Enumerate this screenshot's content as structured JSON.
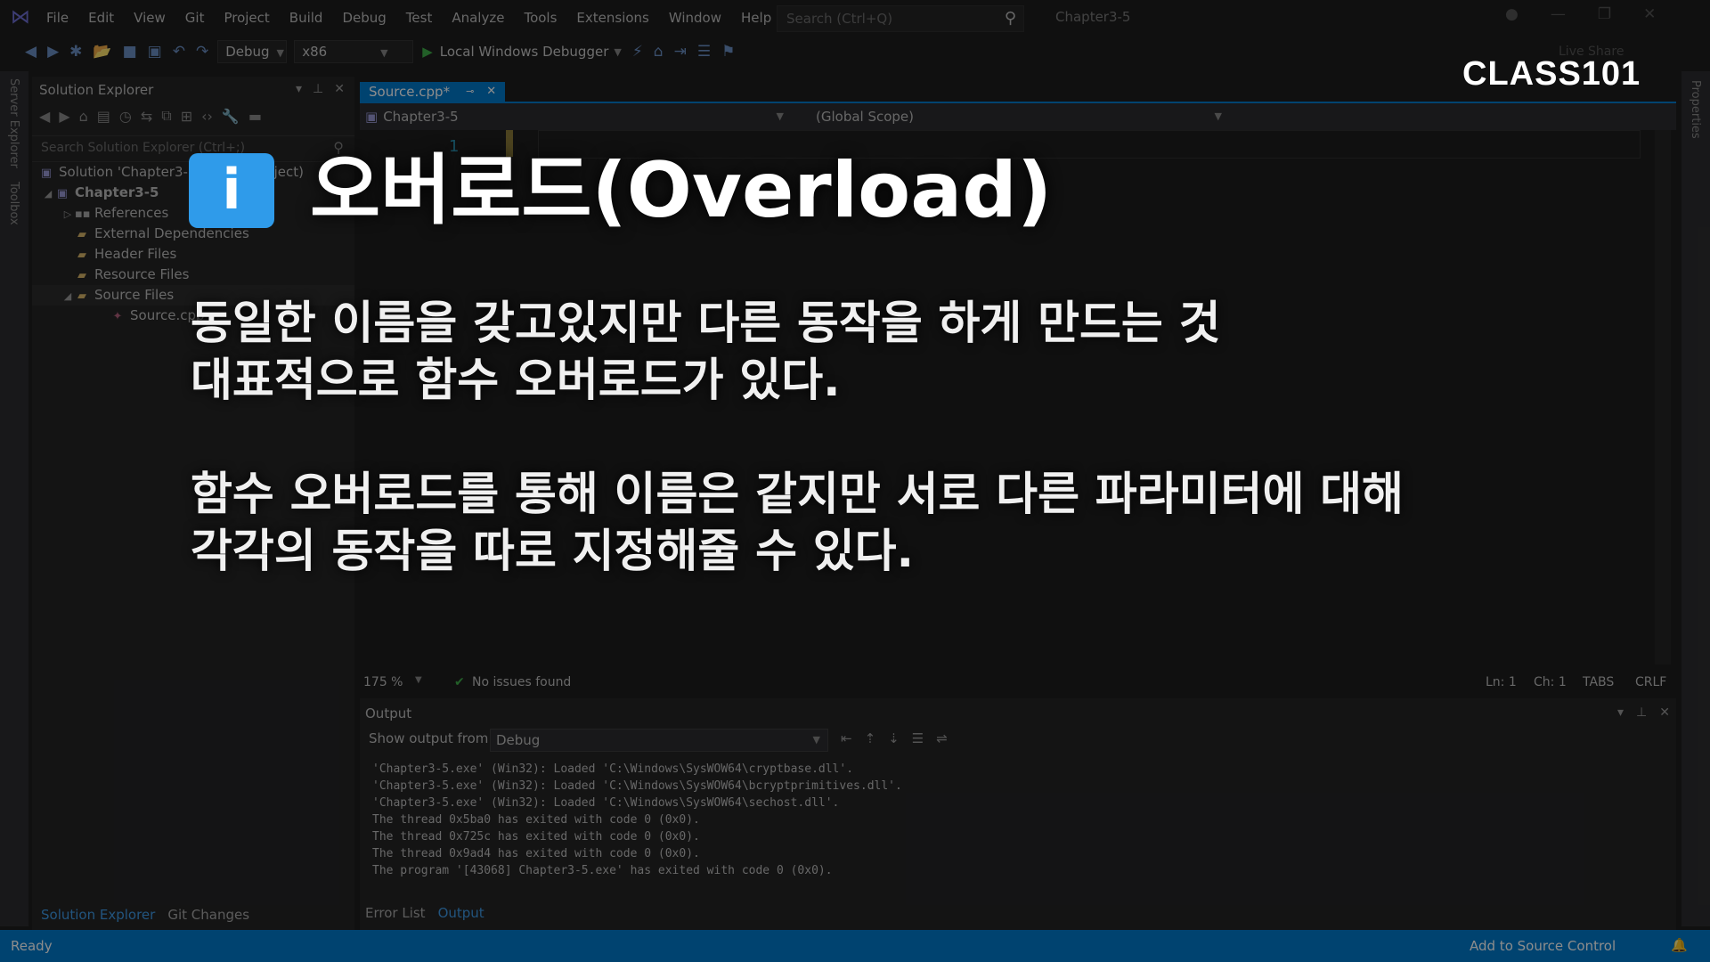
{
  "titlebar": {
    "menu": [
      "File",
      "Edit",
      "View",
      "Git",
      "Project",
      "Build",
      "Debug",
      "Test",
      "Analyze",
      "Tools",
      "Extensions",
      "Window",
      "Help"
    ],
    "search_placeholder": "Search (Ctrl+Q)",
    "project_title": "Chapter3-5"
  },
  "toolbar": {
    "config": "Debug",
    "platform": "x86",
    "run_label": "Local Windows Debugger",
    "live_share": "Live Share"
  },
  "brand": "CLASS101",
  "side_tabs": {
    "server_explorer": "Server Explorer",
    "toolbox": "Toolbox",
    "properties": "Properties"
  },
  "solution_explorer": {
    "title": "Solution Explorer",
    "search_placeholder": "Search Solution Explorer (Ctrl+;)",
    "items": [
      {
        "label": "Solution 'Chapter3-5' (1 of 1 project)"
      },
      {
        "label": "Chapter3-5"
      },
      {
        "label": "References"
      },
      {
        "label": "External Dependencies"
      },
      {
        "label": "Header Files"
      },
      {
        "label": "Resource Files"
      },
      {
        "label": "Source Files"
      },
      {
        "label": "Source.cpp"
      }
    ],
    "bottom_tabs": [
      "Solution Explorer",
      "Git Changes"
    ]
  },
  "editor": {
    "tab_label": "Source.cpp*",
    "nav_project": "Chapter3-5",
    "nav_scope": "(Global Scope)",
    "line_number": "1",
    "zoom": "175 %",
    "issues": "No issues found",
    "ln": "Ln: 1",
    "ch": "Ch: 1",
    "tabs": "TABS",
    "eol": "CRLF"
  },
  "output": {
    "title": "Output",
    "show_from_label": "Show output from:",
    "show_from_value": "Debug",
    "lines": [
      "'Chapter3-5.exe' (Win32): Loaded 'C:\\Windows\\SysWOW64\\cryptbase.dll'.",
      "'Chapter3-5.exe' (Win32): Loaded 'C:\\Windows\\SysWOW64\\bcryptprimitives.dll'.",
      "'Chapter3-5.exe' (Win32): Loaded 'C:\\Windows\\SysWOW64\\sechost.dll'.",
      "The thread 0x5ba0 has exited with code 0 (0x0).",
      "The thread 0x725c has exited with code 0 (0x0).",
      "The thread 0x9ad4 has exited with code 0 (0x0).",
      "The program '[43068] Chapter3-5.exe' has exited with code 0 (0x0)."
    ],
    "tabs": [
      "Error List",
      "Output"
    ]
  },
  "status": {
    "ready": "Ready",
    "source_control": "Add to Source Control"
  },
  "overlay": {
    "icon": "i",
    "title": "오버로드(Overload)",
    "para1": [
      "동일한 이름을 갖고있지만 다른 동작을 하게 만드는 것",
      "대표적으로 함수 오버로드가 있다."
    ],
    "para2": [
      "함수 오버로드를 통해 이름은 같지만 서로 다른 파라미터에 대해",
      "각각의 동작을 따로 지정해줄 수 있다."
    ]
  },
  "colors": {
    "accent": "#007acc",
    "info_icon": "#2f9bea"
  }
}
